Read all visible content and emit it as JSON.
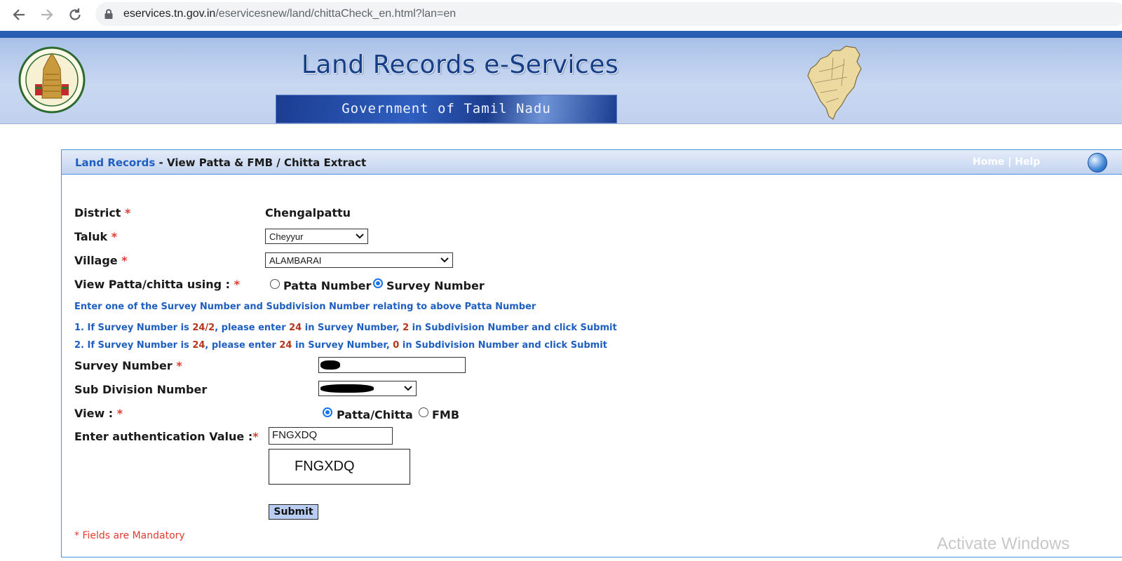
{
  "browser": {
    "url_host": "eservices.tn.gov.in",
    "url_path": "/eservicesnew/land/chittaCheck_en.html?lan=en"
  },
  "header": {
    "site_title": "Land Records e-Services",
    "gov_banner": "Government of Tamil Nadu"
  },
  "panel": {
    "breadcrumb_link": "Land Records",
    "breadcrumb_rest": " - View Patta & FMB / Chitta Extract",
    "home_link": "Home",
    "separator": "|",
    "help_link": "Help"
  },
  "form": {
    "district_label": "District",
    "district_value": "Chengalpattu",
    "taluk_label": "Taluk",
    "taluk_value": "Cheyyur",
    "village_label": "Village",
    "village_value": "ALAMBARAI",
    "view_using_label": "View Patta/chitta using :",
    "option_patta_number": "Patta Number",
    "option_survey_number": "Survey Number",
    "instruction_heading": "Enter one of the Survey Number and Subdivision Number relating to above Patta Number",
    "example1": {
      "prefix": "1. If Survey Number is ",
      "survey": "24/2",
      "mid1": ", please enter ",
      "num": "24",
      "mid2": " in Survey Number, ",
      "sub": "2",
      "suffix": " in Subdivision Number and click Submit"
    },
    "example2": {
      "prefix": "2. If Survey Number is ",
      "survey": "24",
      "mid1": ", please enter ",
      "num": "24",
      "mid2": " in Survey Number, ",
      "sub": "0",
      "suffix": " in Subdivision Number and click Submit"
    },
    "survey_number_label": "Survey Number",
    "sub_division_label": "Sub Division Number",
    "view_label": "View :",
    "option_patta_chitta": "Patta/Chitta",
    "option_fmb": "FMB",
    "auth_label": "Enter authentication Value :",
    "auth_value": "FNGXDQ",
    "captcha_text": "FNGXDQ",
    "submit_label": "Submit",
    "required_marker": "*",
    "mandatory_note": "* Fields are Mandatory"
  },
  "os": {
    "watermark": "Activate Windows"
  },
  "colors": {
    "link_blue": "#1f5fbf",
    "required_red": "#e03c31",
    "highlight_orange": "#b8341d",
    "panel_border": "#4a90e2"
  },
  "icons": [
    "back-arrow-icon",
    "forward-arrow-icon",
    "reload-icon",
    "lock-icon",
    "chevron-down-icon",
    "globe-icon"
  ]
}
